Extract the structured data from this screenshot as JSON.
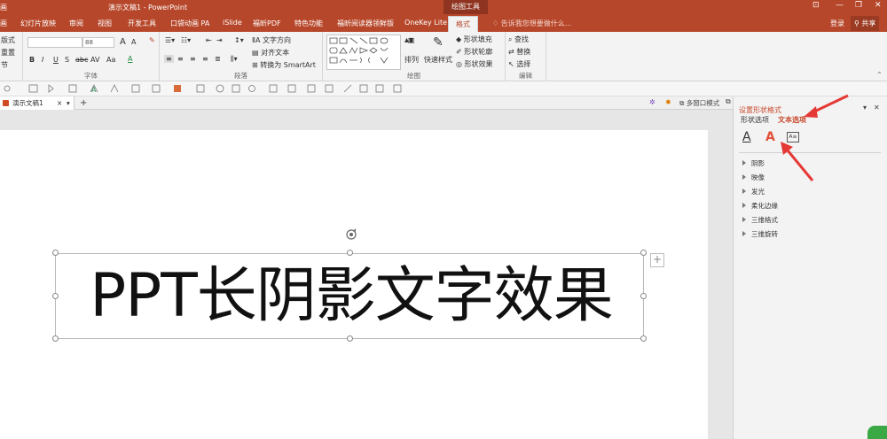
{
  "titlebar": {
    "left_fragment": "画",
    "document_title": "演示文稿1 - PowerPoint",
    "contextual_tab": "绘图工具"
  },
  "window_controls": {
    "pin": "⊡",
    "minimize": "—",
    "maximize": "❐",
    "close": "✕"
  },
  "ribbon_tabs": [
    "画",
    "幻灯片放映",
    "审阅",
    "视图",
    "开发工具",
    "口袋动画 PA",
    "iSlide",
    "福昕PDF",
    "特色功能",
    "福昕阅读器领鲜版",
    "OneKey Lite",
    "格式"
  ],
  "tell_me": "告诉我您想要做什么...",
  "account": {
    "login": "登录",
    "share": "共享"
  },
  "ribbon": {
    "slides": {
      "layout": "版式",
      "reset": "重置",
      "section": "节"
    },
    "font": {
      "label": "字体",
      "size": "88",
      "grow": "A",
      "shrink": "A",
      "bold": "B",
      "italic": "I",
      "underline": "U",
      "strike": "S",
      "abc": "abc",
      "spacing": "AV",
      "case": "Aa",
      "color": "A"
    },
    "paragraph": {
      "label": "段落",
      "text_direction": "文字方向",
      "align_text": "对齐文本",
      "smartart": "转换为 SmartArt"
    },
    "drawing": {
      "label": "绘图",
      "arrange": "排列",
      "quick_styles": "快速样式",
      "shape_fill": "形状填充",
      "shape_outline": "形状轮廓",
      "shape_effects": "形状效果"
    },
    "editing": {
      "label": "编辑",
      "find": "查找",
      "replace": "替换",
      "select": "选择"
    }
  },
  "document_tab": {
    "name": "演示文稿1",
    "close": "×",
    "add": "+"
  },
  "view_toolbar": {
    "multi_window": "多窗口模式"
  },
  "slide": {
    "text": "PPT长阴影文字效果",
    "add_button": "+"
  },
  "format_pane": {
    "title": "设置形状格式",
    "options": [
      "形状选项",
      "文本选项"
    ],
    "active_option": 1,
    "icon_a": "A",
    "icon_effects": "A",
    "collapse": "▾",
    "close": "✕",
    "sections": [
      "阴影",
      "映像",
      "发光",
      "柔化边缘",
      "三维格式",
      "三维旋转"
    ]
  },
  "colors": {
    "accent": "#b7472a",
    "pane_title": "#c8472a",
    "arrow": "#e53935"
  }
}
